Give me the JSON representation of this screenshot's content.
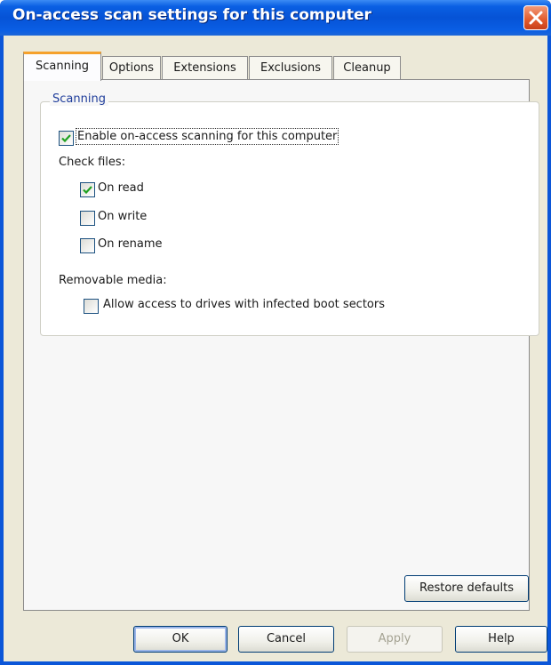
{
  "window": {
    "title": "On-access scan settings for this computer"
  },
  "tabs": [
    {
      "label": "Scanning",
      "active": true
    },
    {
      "label": "Options",
      "active": false
    },
    {
      "label": "Extensions",
      "active": false
    },
    {
      "label": "Exclusions",
      "active": false
    },
    {
      "label": "Cleanup",
      "active": false
    }
  ],
  "scanning_group": {
    "label": "Scanning",
    "enable_onaccess": {
      "label": "Enable on-access scanning for this computer",
      "checked": true
    },
    "check_files_label": "Check files:",
    "on_read": {
      "label": "On read",
      "checked": true
    },
    "on_write": {
      "label": "On write",
      "checked": false
    },
    "on_rename": {
      "label": "On rename",
      "checked": false
    },
    "removable_media_label": "Removable media:",
    "allow_infected_boot": {
      "label": "Allow access to drives with infected boot sectors",
      "checked": false
    }
  },
  "buttons": {
    "restore_defaults": "Restore defaults",
    "ok": "OK",
    "cancel": "Cancel",
    "apply": "Apply",
    "help": "Help"
  },
  "colors": {
    "titlebar": "#0653d6",
    "active_tab_accent": "#f5a12c",
    "dialog_face": "#ece9d8",
    "check_mark": "#21a121"
  }
}
